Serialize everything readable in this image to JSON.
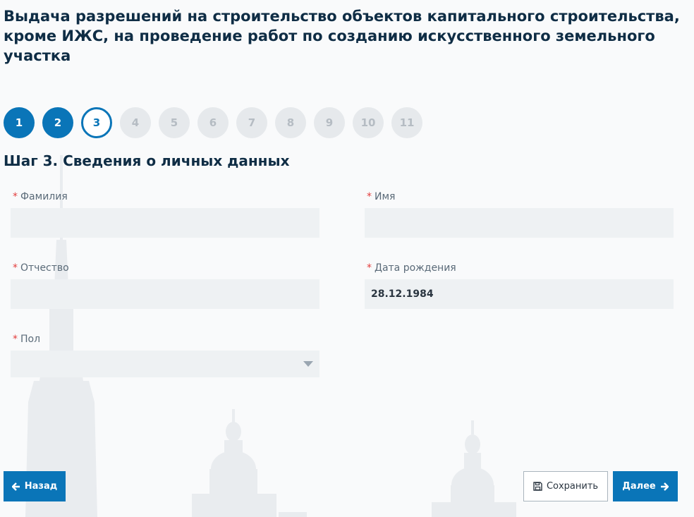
{
  "page": {
    "title": "Выдача разрешений на строительство объектов капитального строительства, кроме ИЖС, на проведение работ по созданию искусственного земельного участка"
  },
  "stepper": {
    "steps": [
      {
        "label": "1",
        "state": "done"
      },
      {
        "label": "2",
        "state": "done"
      },
      {
        "label": "3",
        "state": "current"
      },
      {
        "label": "4",
        "state": "todo"
      },
      {
        "label": "5",
        "state": "todo"
      },
      {
        "label": "6",
        "state": "todo"
      },
      {
        "label": "7",
        "state": "todo"
      },
      {
        "label": "8",
        "state": "todo"
      },
      {
        "label": "9",
        "state": "todo"
      },
      {
        "label": "10",
        "state": "todo"
      },
      {
        "label": "11",
        "state": "todo"
      }
    ]
  },
  "step": {
    "title": "Шаг 3. Сведения о личных данных"
  },
  "form": {
    "required_mark": "*",
    "surname": {
      "label": "Фамилия",
      "value": ""
    },
    "name": {
      "label": "Имя",
      "value": ""
    },
    "patronymic": {
      "label": "Отчество",
      "value": ""
    },
    "birth_date": {
      "label": "Дата рождения",
      "value": "28.12.1984"
    },
    "gender": {
      "label": "Пол",
      "value": ""
    }
  },
  "buttons": {
    "back": "Назад",
    "save": "Сохранить",
    "next": "Далее"
  },
  "icons": {
    "back": "arrow-left-icon",
    "save": "floppy-disk-icon",
    "next": "arrow-right-icon",
    "select": "caret-down-icon"
  },
  "colors": {
    "primary": "#0a75b8",
    "title": "#0f2d45",
    "required": "#e23c3c",
    "input_bg": "#eef1f3"
  }
}
